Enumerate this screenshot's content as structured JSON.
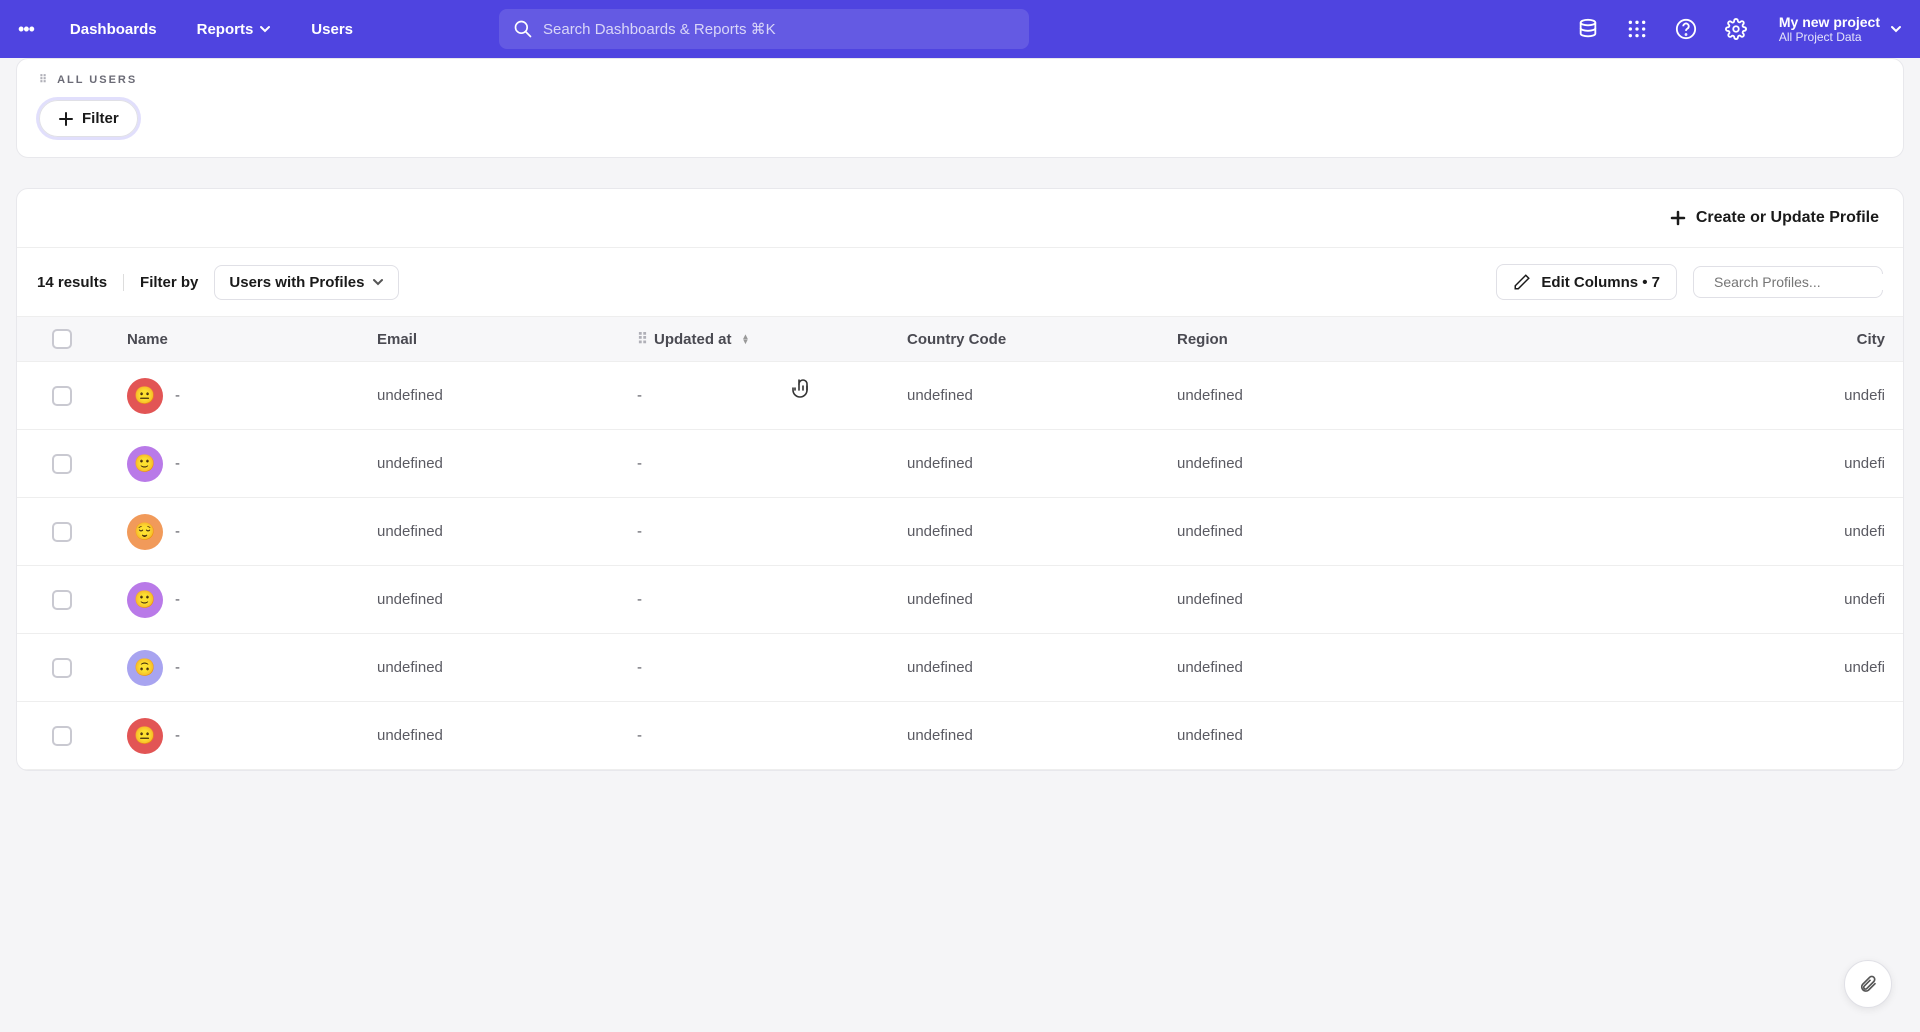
{
  "header": {
    "nav": {
      "dashboards": "Dashboards",
      "reports": "Reports",
      "users": "Users"
    },
    "search_placeholder": "Search Dashboards & Reports ⌘K",
    "project": {
      "name": "My new project",
      "subtitle": "All Project Data"
    }
  },
  "filter_card": {
    "title": "ALL USERS",
    "filter_button": "Filter"
  },
  "main": {
    "create_profile": "Create or Update Profile",
    "results_count": "14 results",
    "filter_by_label": "Filter by",
    "filter_dropdown": "Users with Profiles",
    "edit_columns": "Edit Columns • 7",
    "profile_search_placeholder": "Search Profiles..."
  },
  "columns": {
    "name": "Name",
    "email": "Email",
    "updated": "Updated at",
    "country": "Country Code",
    "region": "Region",
    "city": "City"
  },
  "rows": [
    {
      "avatar_color": "#e25555",
      "avatar_face": "😐",
      "name": "-",
      "email": "undefined",
      "updated": "-",
      "country": "undefined",
      "region": "undefined",
      "city": "undefi"
    },
    {
      "avatar_color": "#b97ae8",
      "avatar_face": "🙂",
      "name": "-",
      "email": "undefined",
      "updated": "-",
      "country": "undefined",
      "region": "undefined",
      "city": "undefi"
    },
    {
      "avatar_color": "#f19a5a",
      "avatar_face": "😌",
      "name": "-",
      "email": "undefined",
      "updated": "-",
      "country": "undefined",
      "region": "undefined",
      "city": "undefi"
    },
    {
      "avatar_color": "#b97ae8",
      "avatar_face": "🙂",
      "name": "-",
      "email": "undefined",
      "updated": "-",
      "country": "undefined",
      "region": "undefined",
      "city": "undefi"
    },
    {
      "avatar_color": "#a8a4f0",
      "avatar_face": "🙃",
      "name": "-",
      "email": "undefined",
      "updated": "-",
      "country": "undefined",
      "region": "undefined",
      "city": "undefi"
    },
    {
      "avatar_color": "#e25555",
      "avatar_face": "😐",
      "name": "-",
      "email": "undefined",
      "updated": "-",
      "country": "undefined",
      "region": "undefined",
      "city": ""
    }
  ]
}
